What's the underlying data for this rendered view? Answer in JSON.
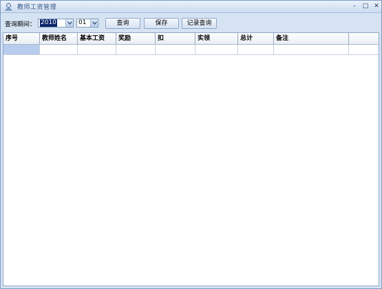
{
  "window": {
    "title": "教师工资管理",
    "controls": [
      "–",
      "□",
      "✕"
    ]
  },
  "toolbar": {
    "period_label": "查询期间：",
    "year_value": "2010",
    "month_value": "01",
    "query_label": "查询",
    "save_label": "保存",
    "records_label": "记录查询"
  },
  "table": {
    "columns": [
      "序号",
      "教师姓名",
      "基本工资",
      "奖励",
      "扣",
      "实领",
      "总计",
      "备注",
      ""
    ],
    "rows": [
      [
        "",
        "",
        "",
        "",
        "",
        "",
        "",
        "",
        ""
      ]
    ]
  }
}
